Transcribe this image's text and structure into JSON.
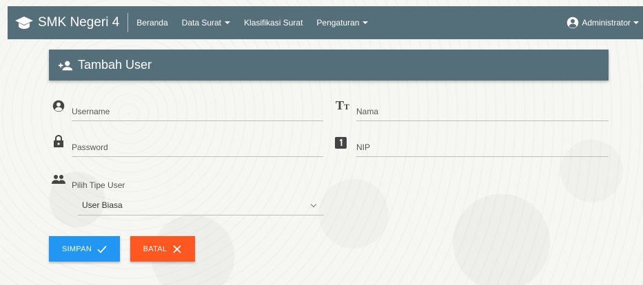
{
  "navbar": {
    "brand": "SMK Negeri 4",
    "items": [
      {
        "label": "Beranda",
        "dropdown": false
      },
      {
        "label": "Data Surat",
        "dropdown": true
      },
      {
        "label": "Klasifikasi Surat",
        "dropdown": false
      },
      {
        "label": "Pengaturan",
        "dropdown": true
      }
    ],
    "user": "Administrator"
  },
  "card": {
    "title": "Tambah User"
  },
  "form": {
    "username_label": "Username",
    "nama_label": "Nama",
    "password_label": "Password",
    "nip_label": "NIP",
    "tipe_label": "Pilih Tipe User",
    "tipe_value": "User Biasa"
  },
  "buttons": {
    "save": "SIMPAN",
    "cancel": "BATAL"
  },
  "colors": {
    "primary": "#546e7a",
    "save": "#2196f3",
    "cancel": "#ff5722"
  }
}
